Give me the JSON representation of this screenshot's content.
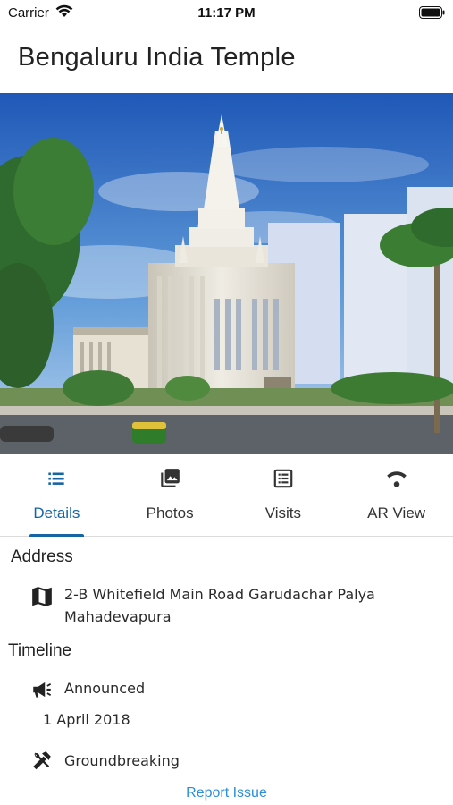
{
  "status_bar": {
    "carrier": "Carrier",
    "time": "11:17 PM"
  },
  "header": {
    "title": "Bengaluru India Temple"
  },
  "tabs": [
    {
      "label": "Details",
      "icon": "list-icon",
      "active": true
    },
    {
      "label": "Photos",
      "icon": "photo-library-icon",
      "active": false
    },
    {
      "label": "Visits",
      "icon": "list-alt-icon",
      "active": false
    },
    {
      "label": "AR View",
      "icon": "wifi-signal-icon",
      "active": false
    }
  ],
  "details": {
    "address_heading": "Address",
    "address_line1": "2-B Whitefield Main Road Garudachar Palya",
    "address_line2": "Mahadevapura",
    "timeline_heading": "Timeline",
    "announced_label": "Announced",
    "announced_date": "1 April 2018",
    "groundbreaking_label": "Groundbreaking"
  },
  "footer": {
    "report_issue": "Report Issue"
  },
  "colors": {
    "accent": "#1565a6",
    "link": "#2d8fd5",
    "divider": "#dcdcdc"
  }
}
